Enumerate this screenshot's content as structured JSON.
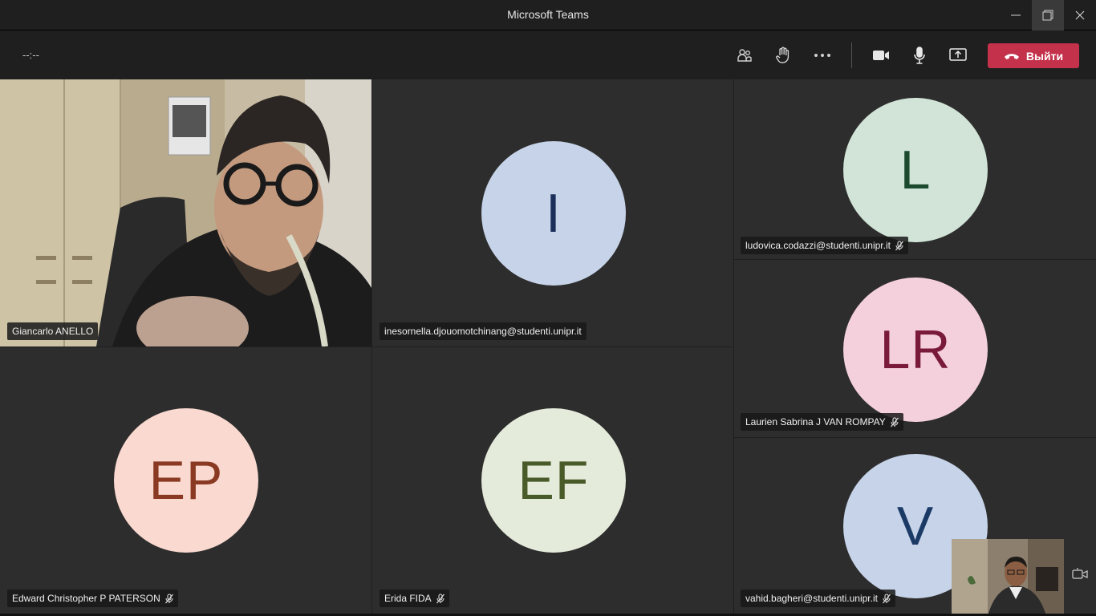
{
  "window": {
    "title": "Microsoft Teams"
  },
  "toolbar": {
    "timer": "--:--",
    "leave_label": "Выйти",
    "icons": [
      "participants-icon",
      "raise-hand-icon",
      "more-icon",
      "camera-icon",
      "microphone-icon",
      "share-screen-icon",
      "hang-up-icon"
    ]
  },
  "colors": {
    "leave": "#c4314b",
    "tile": "#2d2d2d",
    "background": "#1f1f1f"
  },
  "participants": [
    {
      "name": "Giancarlo ANELLO",
      "type": "video",
      "muted": false
    },
    {
      "name": "inesornella.djouomotchinang@studenti.unipr.it",
      "initials": "I",
      "bg": "#c6d3e8",
      "fg": "#1b2f5a",
      "muted": false
    },
    {
      "name": "ludovica.codazzi@studenti.unipr.it",
      "initials": "L",
      "bg": "#d1e4d7",
      "fg": "#1b4a2e",
      "muted": true
    },
    {
      "name": "Laurien Sabrina J VAN ROMPAY",
      "initials": "LR",
      "bg": "#f4d0dc",
      "fg": "#7a1a3b",
      "muted": true
    },
    {
      "name": "Edward Christopher P PATERSON",
      "initials": "EP",
      "bg": "#f9d9d0",
      "fg": "#8a3a22",
      "muted": true
    },
    {
      "name": "Erida FIDA",
      "initials": "EF",
      "bg": "#e5ebdb",
      "fg": "#4a5b2a",
      "muted": true
    },
    {
      "name": "vahid.bagheri@studenti.unipr.it",
      "initials": "V",
      "bg": "#c6d3e8",
      "fg": "#1b3a66",
      "muted": true
    }
  ]
}
